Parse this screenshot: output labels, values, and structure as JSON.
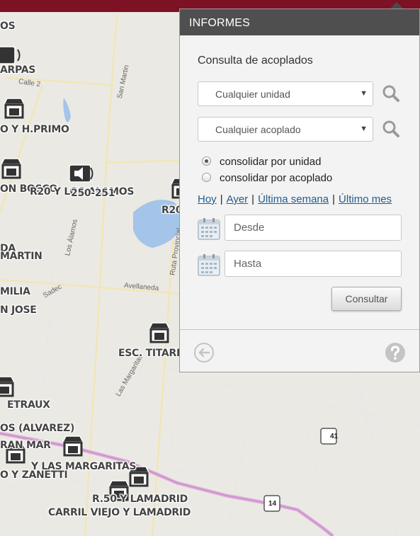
{
  "panel": {
    "title": "INFORMES",
    "subtitle": "Consulta de acoplados",
    "unit_select": {
      "value": "Cualquier unidad"
    },
    "trailer_select": {
      "value": "Cualquier acoplado"
    },
    "radios": [
      {
        "label": "consolidar por unidad",
        "checked": true
      },
      {
        "label": "consolidar por acoplado",
        "checked": false
      }
    ],
    "quick_ranges": [
      "Hoy",
      "Ayer",
      "Última semana",
      "Último mes"
    ],
    "quick_separator": "|",
    "date_from": {
      "placeholder": "Desde"
    },
    "date_to": {
      "placeholder": "Hasta"
    },
    "submit_label": "Consultar"
  },
  "map": {
    "poi_labels": [
      "OS",
      "ARPAS",
      "O Y H.PRIMO",
      "ON BOSCO",
      "R20 Y LOS ALAMOS",
      "250-251",
      "R20",
      "DA",
      "MARTIN",
      "MILIA",
      "N JOSE",
      "ESC. TITARE",
      "ETRAUX",
      "OS (ALVAREZ)",
      "RAN MAR",
      "Y LAS MARGARITAS",
      "O Y ZANETTI",
      "R.50 Y LAMADRID",
      "CARRIL VIEJO Y LAMADRID"
    ],
    "street_labels": [
      "Calle 2",
      "San Martin",
      "Los Álamos",
      "Avellaneda",
      "Ruta Provincial",
      "Sadec",
      "Las Margaritas"
    ],
    "route_shields": [
      "41",
      "14"
    ],
    "colors": {
      "top_bar": "#7d1224",
      "header": "#4f4f4f",
      "link": "#1f5c8f"
    }
  }
}
